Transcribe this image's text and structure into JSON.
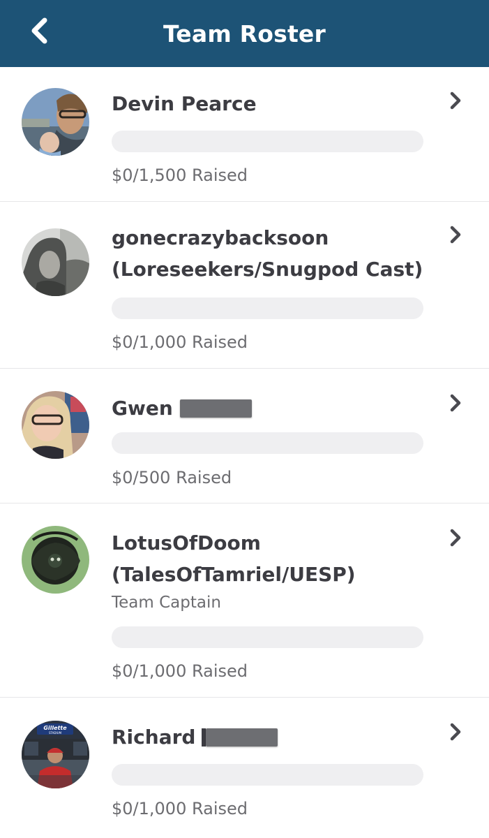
{
  "header": {
    "title": "Team Roster",
    "back_icon": "chevron-left-icon",
    "background": "#1d5376"
  },
  "members": [
    {
      "name": "Devin Pearce",
      "role": "",
      "raised": "$0/1,500 Raised",
      "progress": 0,
      "avatar": "person-with-baby-photo"
    },
    {
      "name": "gonecrazybacksoon (Loreseekers/Snugpod Cast)",
      "role": "",
      "raised": "$0/1,000 Raised",
      "progress": 0,
      "avatar": "hooded-person-photo"
    },
    {
      "name": "Gwen",
      "role": "",
      "raised": "$0/500 Raised",
      "progress": 0,
      "avatar": "woman-glasses-photo",
      "redacted": true
    },
    {
      "name": "LotusOfDoom (TalesOfTamriel/UESP)",
      "role": "Team Captain",
      "raised": "$0/1,000 Raised",
      "progress": 0,
      "avatar": "dark-emblem-logo"
    },
    {
      "name": "Richard",
      "role": "",
      "raised": "$0/1,000 Raised",
      "progress": 0,
      "avatar": "stadium-photo",
      "stadium_sign": "Gillette STADIUM",
      "redacted": true
    }
  ],
  "row_chevron_icon": "chevron-right-icon"
}
